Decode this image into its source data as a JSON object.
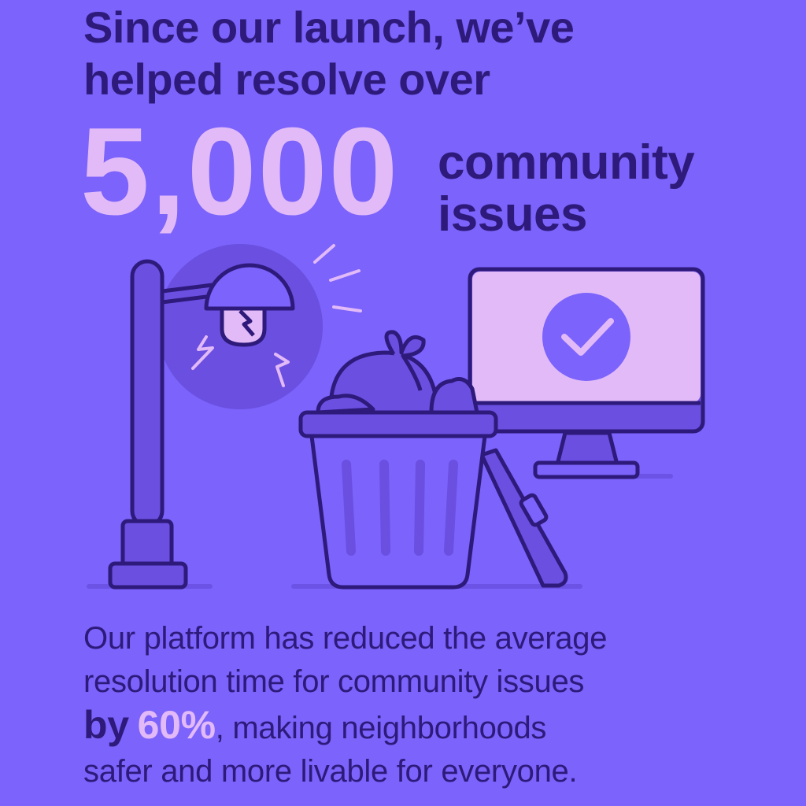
{
  "headline": {
    "line1": "Since our launch, we’ve",
    "line2": "helped resolve over"
  },
  "stat": {
    "number": "5,000",
    "label_line1": "community",
    "label_line2": "issues"
  },
  "body": {
    "line1": "Our platform has reduced the average",
    "line2": "resolution time for community issues",
    "by": "by",
    "percent": "60%",
    "line3_rest": ", making neighborhoods",
    "line4": "safer and more livable for everyone."
  },
  "illustration": {
    "icons": [
      "broken-streetlight-icon",
      "overflowing-trash-can-icon",
      "monitor-checkmark-icon"
    ]
  },
  "colors": {
    "background": "#7b63fb",
    "text": "#2e1a7a",
    "accent": "#e2baf8"
  }
}
